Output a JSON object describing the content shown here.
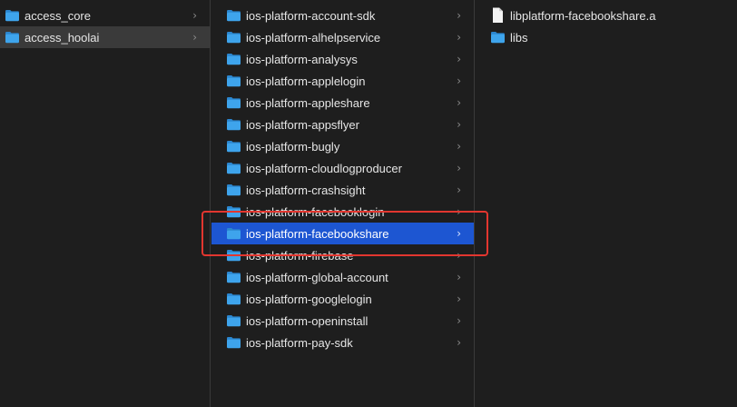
{
  "column1": {
    "items": [
      {
        "label": "access_core",
        "type": "folder",
        "state": "normal"
      },
      {
        "label": "access_hoolai",
        "type": "folder",
        "state": "selected-inactive"
      }
    ]
  },
  "column2": {
    "items": [
      {
        "label": "ios-platform-account-sdk",
        "type": "folder",
        "state": "normal"
      },
      {
        "label": "ios-platform-alhelpservice",
        "type": "folder",
        "state": "normal"
      },
      {
        "label": "ios-platform-analysys",
        "type": "folder",
        "state": "normal"
      },
      {
        "label": "ios-platform-applelogin",
        "type": "folder",
        "state": "normal"
      },
      {
        "label": "ios-platform-appleshare",
        "type": "folder",
        "state": "normal"
      },
      {
        "label": "ios-platform-appsflyer",
        "type": "folder",
        "state": "normal"
      },
      {
        "label": "ios-platform-bugly",
        "type": "folder",
        "state": "normal"
      },
      {
        "label": "ios-platform-cloudlogproducer",
        "type": "folder",
        "state": "normal"
      },
      {
        "label": "ios-platform-crashsight",
        "type": "folder",
        "state": "normal"
      },
      {
        "label": "ios-platform-facebooklogin",
        "type": "folder",
        "state": "normal"
      },
      {
        "label": "ios-platform-facebookshare",
        "type": "folder",
        "state": "selected-active"
      },
      {
        "label": "ios-platform-firebase",
        "type": "folder",
        "state": "normal"
      },
      {
        "label": "ios-platform-global-account",
        "type": "folder",
        "state": "normal"
      },
      {
        "label": "ios-platform-googlelogin",
        "type": "folder",
        "state": "normal"
      },
      {
        "label": "ios-platform-openinstall",
        "type": "folder",
        "state": "normal"
      },
      {
        "label": "ios-platform-pay-sdk",
        "type": "folder",
        "state": "normal"
      }
    ]
  },
  "column3": {
    "items": [
      {
        "label": "libplatform-facebookshare.a",
        "type": "file",
        "state": "normal"
      },
      {
        "label": "libs",
        "type": "folder",
        "state": "normal"
      }
    ]
  },
  "colors": {
    "background": "#1e1e1e",
    "selection_active": "#1d56d2",
    "selection_inactive": "#3a3a3a",
    "folder_icon": "#3ea4ec",
    "highlight_annotation": "#e2362f"
  },
  "icons": {
    "folder": "folder-icon",
    "file": "document-icon",
    "disclosure": "chevron-right-icon",
    "chevron_glyph": "›"
  }
}
